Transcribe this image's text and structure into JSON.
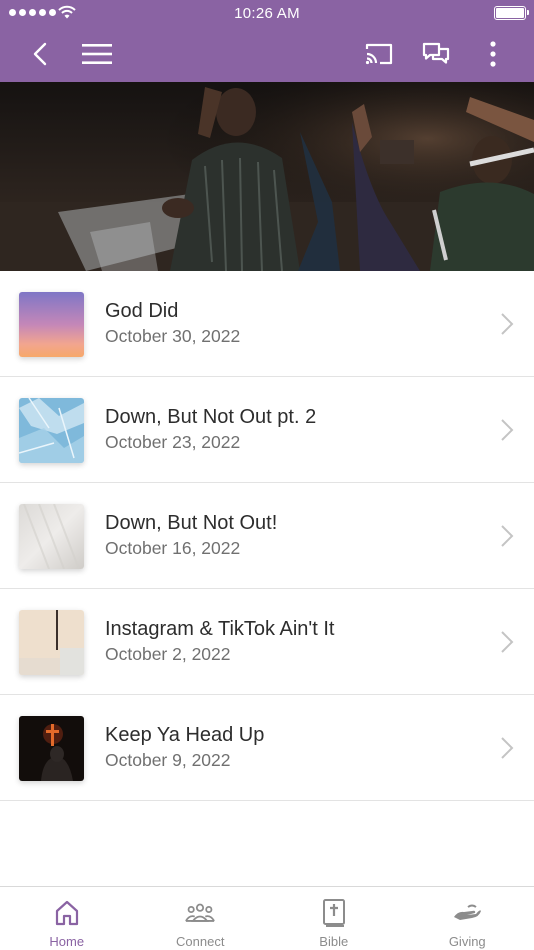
{
  "status_bar": {
    "time": "10:26 AM"
  },
  "header": {
    "icons": [
      "back-icon",
      "menu-icon",
      "cast-icon",
      "chat-icon",
      "more-vertical-icon"
    ]
  },
  "colors": {
    "brand": "#8a63a3",
    "divider": "#e3e3e3",
    "tab_inactive": "#8c8c8c"
  },
  "sermons": [
    {
      "title": "God Did",
      "date": "October 30, 2022"
    },
    {
      "title": "Down, But Not Out pt. 2",
      "date": "October 23, 2022"
    },
    {
      "title": "Down, But Not Out!",
      "date": "October 16, 2022"
    },
    {
      "title": "Instagram & TikTok Ain't It",
      "date": "October 2, 2022"
    },
    {
      "title": "Keep Ya Head Up",
      "date": "October 9, 2022"
    }
  ],
  "tabs": [
    {
      "label": "Home",
      "icon": "home-icon",
      "active": true
    },
    {
      "label": "Connect",
      "icon": "group-icon",
      "active": false
    },
    {
      "label": "Bible",
      "icon": "bible-icon",
      "active": false
    },
    {
      "label": "Giving",
      "icon": "giving-hand-icon",
      "active": false
    }
  ]
}
